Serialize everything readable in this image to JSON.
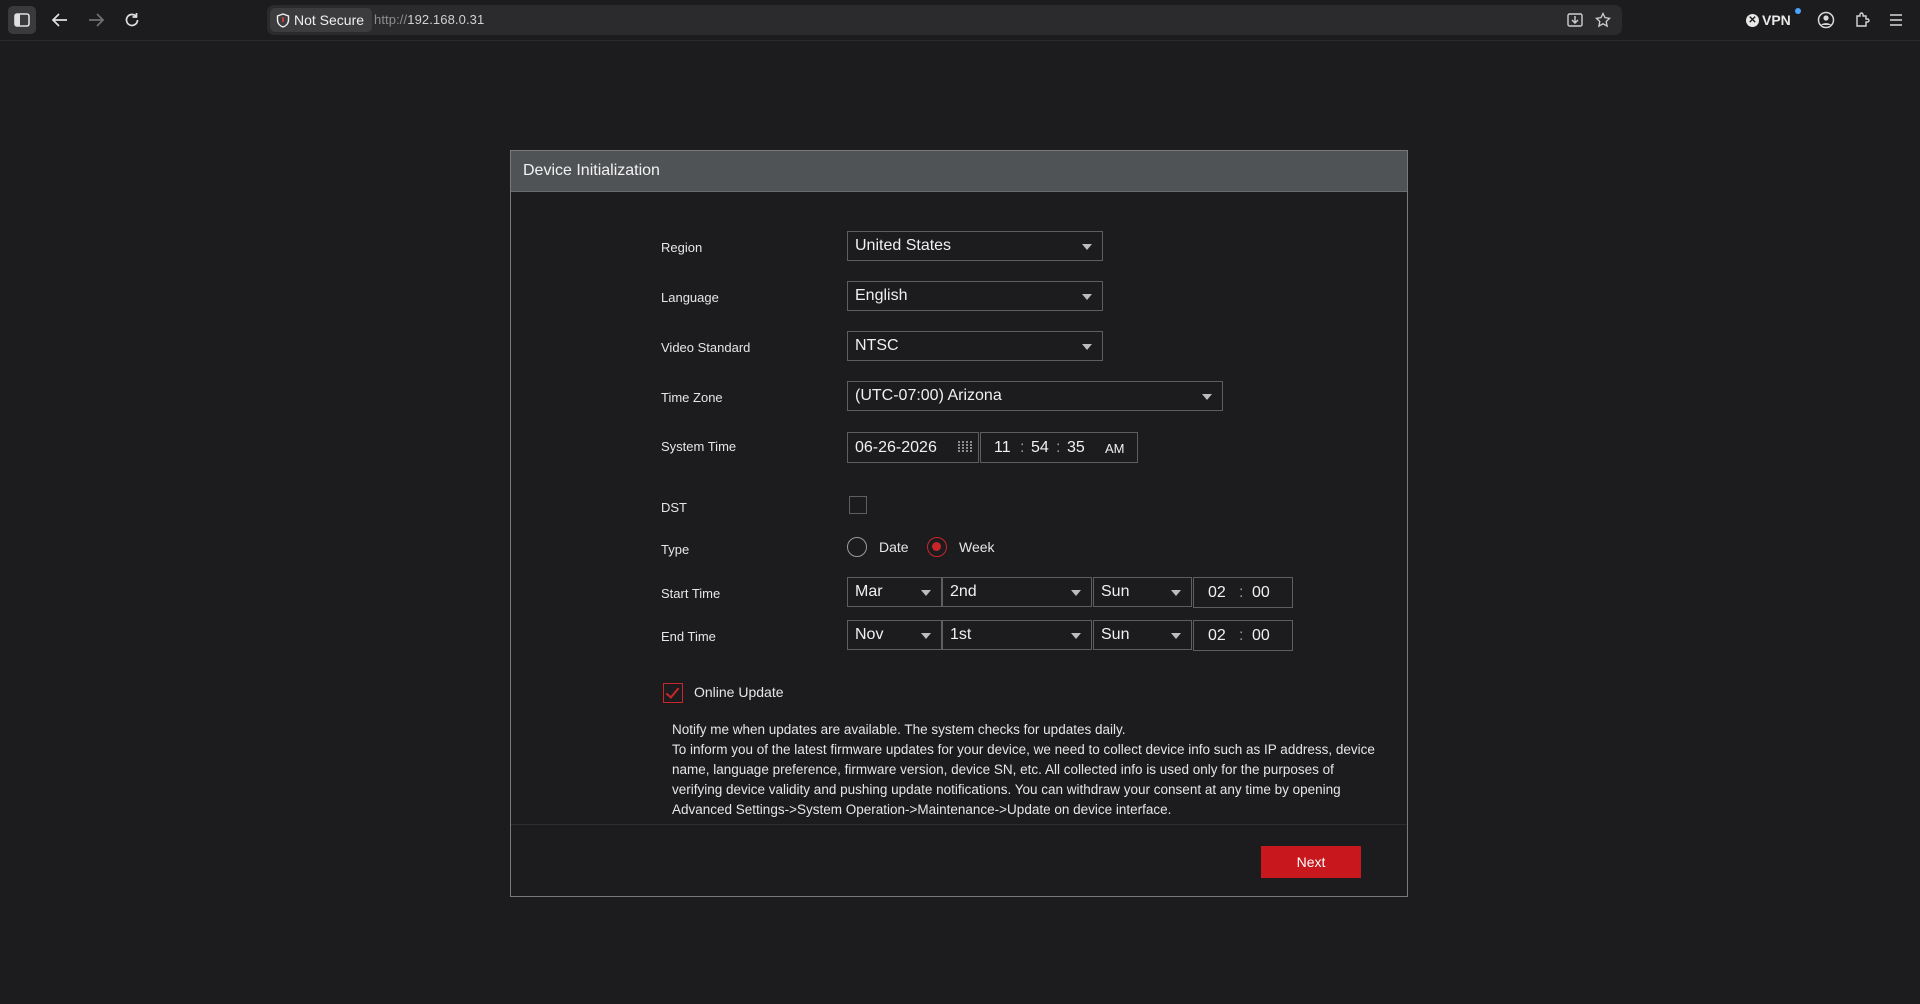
{
  "browser": {
    "security_label": "Not Secure",
    "url_protocol": "http://",
    "url_host": "192.168.0.31",
    "vpn_label": "VPN"
  },
  "dialog": {
    "title": "Device Initialization",
    "region": {
      "label": "Region",
      "value": "United States"
    },
    "language": {
      "label": "Language",
      "value": "English"
    },
    "video_standard": {
      "label": "Video Standard",
      "value": "NTSC"
    },
    "time_zone": {
      "label": "Time Zone",
      "value": "(UTC-07:00) Arizona"
    },
    "system_time": {
      "label": "System Time",
      "date": "06-26-2026",
      "hour": "11",
      "minute": "54",
      "second": "35",
      "ampm": "AM",
      "sep": ":"
    },
    "dst": {
      "label": "DST",
      "checked": false
    },
    "type": {
      "label": "Type",
      "options": [
        "Date",
        "Week"
      ],
      "selected": "Week"
    },
    "start_time": {
      "label": "Start Time",
      "month": "Mar",
      "week": "2nd",
      "day": "Sun",
      "hour": "02",
      "minute": "00"
    },
    "end_time": {
      "label": "End Time",
      "month": "Nov",
      "week": "1st",
      "day": "Sun",
      "hour": "02",
      "minute": "00"
    },
    "online_update": {
      "label": "Online Update",
      "checked": true,
      "notice_line1": "Notify me when updates are available. The system checks for updates daily.",
      "notice_line2": "To inform you of the latest firmware updates for your device, we need to collect device info such as IP address, device name, language preference, firmware version, device SN, etc. All collected info is used only for the purposes of verifying device validity and pushing update notifications. You can withdraw your consent at any time by opening Advanced Settings->System Operation->Maintenance->Update on device interface."
    },
    "next_label": "Next"
  },
  "colors": {
    "accent": "#c8171d",
    "header_bg": "#505356",
    "page_bg": "#1c1c1e"
  }
}
